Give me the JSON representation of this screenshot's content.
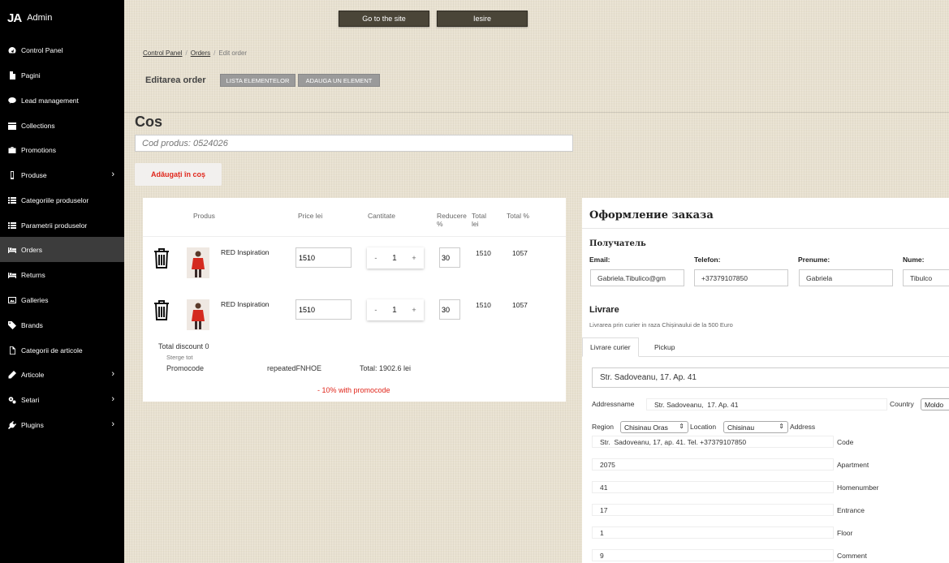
{
  "brand": {
    "logo": "JA",
    "name": "Admin"
  },
  "sidebar": {
    "items": [
      {
        "label": "Control Panel",
        "icon": "dashboard-icon",
        "arrow": ""
      },
      {
        "label": "Pagini",
        "icon": "file-icon",
        "arrow": ""
      },
      {
        "label": "Lead management",
        "icon": "comment-icon",
        "arrow": ""
      },
      {
        "label": "Collections",
        "icon": "calendar-icon",
        "arrow": ""
      },
      {
        "label": "Promotions",
        "icon": "briefcase-icon",
        "arrow": ""
      },
      {
        "label": "Produse",
        "icon": "mobile-icon",
        "arrow": "›"
      },
      {
        "label": "Categoriile produselor",
        "icon": "list-icon",
        "arrow": ""
      },
      {
        "label": "Parametrii produselor",
        "icon": "list-icon",
        "arrow": ""
      },
      {
        "label": "Orders",
        "icon": "bed-icon",
        "arrow": ""
      },
      {
        "label": "Returns",
        "icon": "bed-icon",
        "arrow": ""
      },
      {
        "label": "Galleries",
        "icon": "image-icon",
        "arrow": ""
      },
      {
        "label": "Brands",
        "icon": "tag-icon",
        "arrow": ""
      },
      {
        "label": "Categorii de articole",
        "icon": "file-outline-icon",
        "arrow": ""
      },
      {
        "label": "Articole",
        "icon": "pencil-icon",
        "arrow": "›"
      },
      {
        "label": "Setari",
        "icon": "cogs-icon",
        "arrow": "›"
      },
      {
        "label": "Plugins",
        "icon": "plug-icon",
        "arrow": "›"
      }
    ],
    "active": "Orders"
  },
  "topbar": {
    "site_button": "Go to the site",
    "exit_button": "Iesire"
  },
  "breadcrumb": {
    "home": "Control Panel",
    "orders": "Orders",
    "current": "Edit order",
    "sep": "/"
  },
  "page": {
    "title": "Editarea order",
    "list_button": "LISTA ELEMENTELOR",
    "add_button": "ADAUGA UN ELEMENT"
  },
  "cart": {
    "title": "Cos",
    "product_placeholder": "Cod produs: 0524026",
    "add_button": "Adăugați în coș",
    "headers": {
      "product": "Produs",
      "price": "Price lei",
      "quantity": "Cantitate",
      "discount_line1": "Reducere",
      "discount_line2": "%",
      "total_line1": "Total",
      "total_line2": "lei",
      "total_percent": "Total %"
    },
    "rows": [
      {
        "name": "RED Inspiration",
        "price": "1510",
        "qty": "1",
        "discount": "30",
        "total": "1510",
        "total_percent": "1057"
      },
      {
        "name": "RED Inspiration",
        "price": "1510",
        "qty": "1",
        "discount": "30",
        "total": "1510",
        "total_percent": "1057"
      }
    ],
    "stepper": {
      "minus": "-",
      "plus": "+"
    },
    "total_discount": "Total discount 0",
    "clear_all": "Sterge tot",
    "promocode_label": "Promocode",
    "promocode_value": "repeatedFNHOE",
    "grand_total": "Total: 1902.6 lei",
    "promo_note": "- 10% with promocode"
  },
  "order": {
    "title": "Оформление заказа",
    "recipient": "Получатель",
    "fields": [
      {
        "label": "Email:",
        "value": "Gabriela.Tibulico@gm"
      },
      {
        "label": "Telefon:",
        "value": "+37379107850"
      },
      {
        "label": "Prenume:",
        "value": "Gabriela"
      },
      {
        "label": "Nume:",
        "value": "Tibulco"
      }
    ],
    "delivery_title": "Livrare",
    "delivery_note": "Livrarea prin curier in raza Chișinaului de la 500 Euro",
    "tabs": [
      "Livrare curier",
      "Pickup"
    ],
    "address_main": "Str. Sadoveanu, 17. Ap. 41",
    "addressname_label": "Addressname",
    "addressname_value": "Str. Sadoveanu,  17. Ap. 41",
    "country_label": "Country",
    "country_value": "Moldo",
    "region_label": "Region",
    "region_value": "Chisinau Oras",
    "location_label": "Location",
    "location_value": "Chisinau",
    "address_label": "Address",
    "address_value": "Str.  Sadoveanu, 17, ap. 41. Tel. +37379107850",
    "rows": [
      {
        "label": "Code",
        "value": "2075"
      },
      {
        "label": "Apartment",
        "value": "41"
      },
      {
        "label": "Homenumber",
        "value": "17"
      },
      {
        "label": "Entrance",
        "value": "1"
      },
      {
        "label": "Floor",
        "value": "9"
      },
      {
        "label": "Comment",
        "value": ""
      }
    ]
  }
}
